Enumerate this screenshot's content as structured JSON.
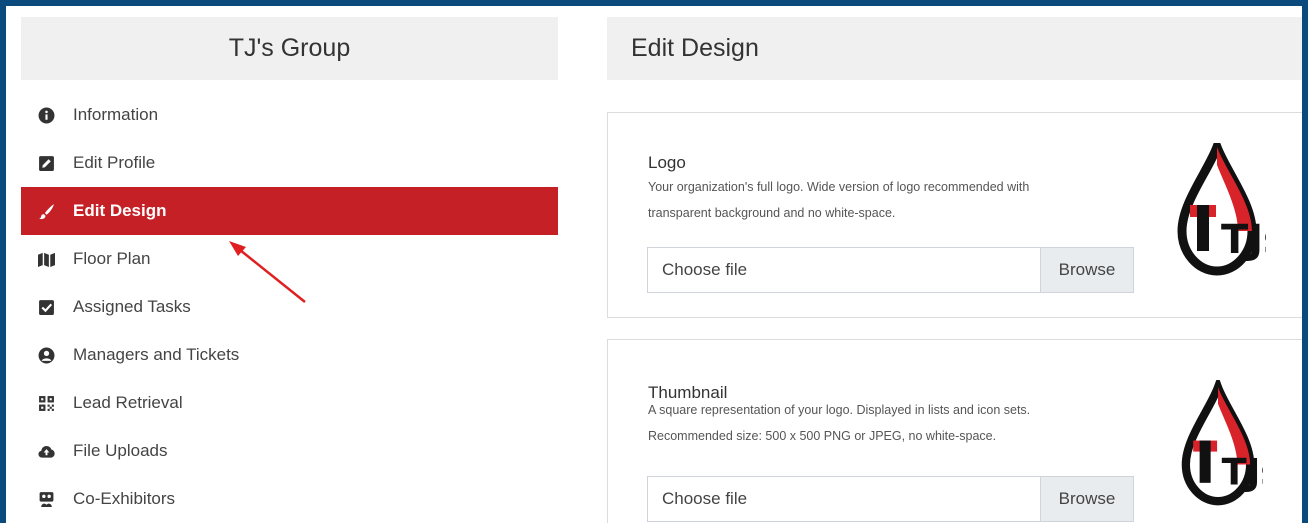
{
  "sidebar": {
    "title": "TJ's Group",
    "items": [
      {
        "label": "Information",
        "icon": "info-circle-icon",
        "active": false
      },
      {
        "label": "Edit Profile",
        "icon": "edit-icon",
        "active": false
      },
      {
        "label": "Edit Design",
        "icon": "paint-brush-icon",
        "active": true
      },
      {
        "label": "Floor Plan",
        "icon": "map-icon",
        "active": false
      },
      {
        "label": "Assigned Tasks",
        "icon": "check-square-icon",
        "active": false
      },
      {
        "label": "Managers and Tickets",
        "icon": "user-circle-icon",
        "active": false
      },
      {
        "label": "Lead Retrieval",
        "icon": "qrcode-icon",
        "active": false
      },
      {
        "label": "File Uploads",
        "icon": "cloud-upload-icon",
        "active": false
      },
      {
        "label": "Co-Exhibitors",
        "icon": "users-icon",
        "active": false
      }
    ]
  },
  "main": {
    "title": "Edit Design",
    "logo_card": {
      "title": "Logo",
      "desc_line1": "Your organization's full logo. Wide version of logo recommended with",
      "desc_line2": "transparent background and no white-space.",
      "file_placeholder": "Choose file",
      "browse_label": "Browse",
      "logo_text": "TJs"
    },
    "thumbnail_card": {
      "title": "Thumbnail",
      "desc_line1": "A square representation of your logo. Displayed in lists and icon sets.",
      "desc_line2": "Recommended size: 500 x 500 PNG or JPEG, no white-space.",
      "file_placeholder": "Choose file",
      "browse_label": "Browse",
      "logo_text": "TJs"
    }
  },
  "colors": {
    "accent": "#c42026",
    "frame": "#0a4a7c",
    "header_bg": "#f0f0f0"
  }
}
